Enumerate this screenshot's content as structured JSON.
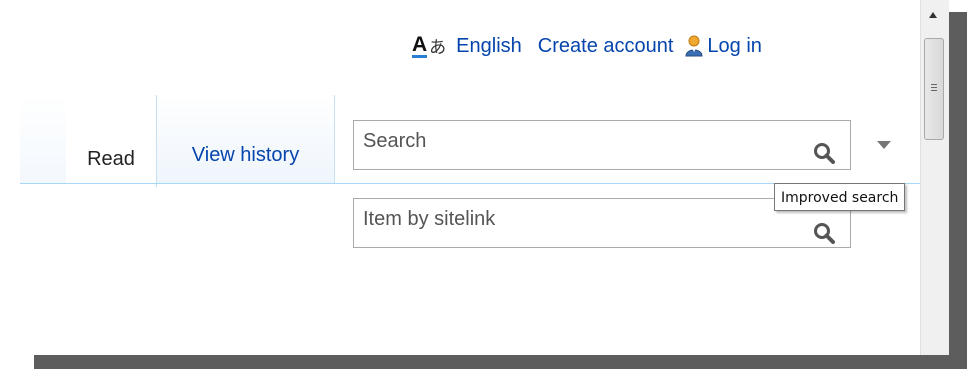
{
  "personal_tools": {
    "language_icon": "language-translate-icon",
    "language_icon_glyph_latin": "A",
    "language_icon_glyph_japanese": "あ",
    "language_label": "English",
    "create_account_label": "Create account",
    "user_icon": "user-icon",
    "login_label": "Log in"
  },
  "tabs": {
    "read_label": "Read",
    "history_label": "View history"
  },
  "search": {
    "main_placeholder": "Search",
    "sitelink_placeholder": "Item by sitelink",
    "search_icon": "magnifier-icon",
    "dropdown_icon": "triangle-down-icon",
    "tooltip": "Improved search"
  },
  "scrollbar": {
    "up_icon": "scroll-up-arrow-icon"
  },
  "colors": {
    "link": "#0645ad",
    "text": "#222222",
    "tab_border": "#a7d7f9",
    "input_border": "#aaaaaa"
  }
}
